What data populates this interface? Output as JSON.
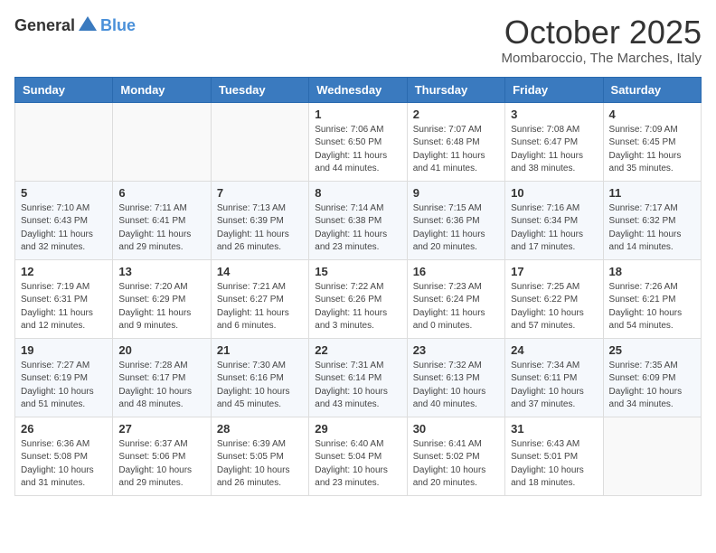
{
  "header": {
    "logo_general": "General",
    "logo_blue": "Blue",
    "month": "October 2025",
    "location": "Mombaroccio, The Marches, Italy"
  },
  "days_of_week": [
    "Sunday",
    "Monday",
    "Tuesday",
    "Wednesday",
    "Thursday",
    "Friday",
    "Saturday"
  ],
  "weeks": [
    [
      {
        "day": "",
        "info": ""
      },
      {
        "day": "",
        "info": ""
      },
      {
        "day": "",
        "info": ""
      },
      {
        "day": "1",
        "info": "Sunrise: 7:06 AM\nSunset: 6:50 PM\nDaylight: 11 hours and 44 minutes."
      },
      {
        "day": "2",
        "info": "Sunrise: 7:07 AM\nSunset: 6:48 PM\nDaylight: 11 hours and 41 minutes."
      },
      {
        "day": "3",
        "info": "Sunrise: 7:08 AM\nSunset: 6:47 PM\nDaylight: 11 hours and 38 minutes."
      },
      {
        "day": "4",
        "info": "Sunrise: 7:09 AM\nSunset: 6:45 PM\nDaylight: 11 hours and 35 minutes."
      }
    ],
    [
      {
        "day": "5",
        "info": "Sunrise: 7:10 AM\nSunset: 6:43 PM\nDaylight: 11 hours and 32 minutes."
      },
      {
        "day": "6",
        "info": "Sunrise: 7:11 AM\nSunset: 6:41 PM\nDaylight: 11 hours and 29 minutes."
      },
      {
        "day": "7",
        "info": "Sunrise: 7:13 AM\nSunset: 6:39 PM\nDaylight: 11 hours and 26 minutes."
      },
      {
        "day": "8",
        "info": "Sunrise: 7:14 AM\nSunset: 6:38 PM\nDaylight: 11 hours and 23 minutes."
      },
      {
        "day": "9",
        "info": "Sunrise: 7:15 AM\nSunset: 6:36 PM\nDaylight: 11 hours and 20 minutes."
      },
      {
        "day": "10",
        "info": "Sunrise: 7:16 AM\nSunset: 6:34 PM\nDaylight: 11 hours and 17 minutes."
      },
      {
        "day": "11",
        "info": "Sunrise: 7:17 AM\nSunset: 6:32 PM\nDaylight: 11 hours and 14 minutes."
      }
    ],
    [
      {
        "day": "12",
        "info": "Sunrise: 7:19 AM\nSunset: 6:31 PM\nDaylight: 11 hours and 12 minutes."
      },
      {
        "day": "13",
        "info": "Sunrise: 7:20 AM\nSunset: 6:29 PM\nDaylight: 11 hours and 9 minutes."
      },
      {
        "day": "14",
        "info": "Sunrise: 7:21 AM\nSunset: 6:27 PM\nDaylight: 11 hours and 6 minutes."
      },
      {
        "day": "15",
        "info": "Sunrise: 7:22 AM\nSunset: 6:26 PM\nDaylight: 11 hours and 3 minutes."
      },
      {
        "day": "16",
        "info": "Sunrise: 7:23 AM\nSunset: 6:24 PM\nDaylight: 11 hours and 0 minutes."
      },
      {
        "day": "17",
        "info": "Sunrise: 7:25 AM\nSunset: 6:22 PM\nDaylight: 10 hours and 57 minutes."
      },
      {
        "day": "18",
        "info": "Sunrise: 7:26 AM\nSunset: 6:21 PM\nDaylight: 10 hours and 54 minutes."
      }
    ],
    [
      {
        "day": "19",
        "info": "Sunrise: 7:27 AM\nSunset: 6:19 PM\nDaylight: 10 hours and 51 minutes."
      },
      {
        "day": "20",
        "info": "Sunrise: 7:28 AM\nSunset: 6:17 PM\nDaylight: 10 hours and 48 minutes."
      },
      {
        "day": "21",
        "info": "Sunrise: 7:30 AM\nSunset: 6:16 PM\nDaylight: 10 hours and 45 minutes."
      },
      {
        "day": "22",
        "info": "Sunrise: 7:31 AM\nSunset: 6:14 PM\nDaylight: 10 hours and 43 minutes."
      },
      {
        "day": "23",
        "info": "Sunrise: 7:32 AM\nSunset: 6:13 PM\nDaylight: 10 hours and 40 minutes."
      },
      {
        "day": "24",
        "info": "Sunrise: 7:34 AM\nSunset: 6:11 PM\nDaylight: 10 hours and 37 minutes."
      },
      {
        "day": "25",
        "info": "Sunrise: 7:35 AM\nSunset: 6:09 PM\nDaylight: 10 hours and 34 minutes."
      }
    ],
    [
      {
        "day": "26",
        "info": "Sunrise: 6:36 AM\nSunset: 5:08 PM\nDaylight: 10 hours and 31 minutes."
      },
      {
        "day": "27",
        "info": "Sunrise: 6:37 AM\nSunset: 5:06 PM\nDaylight: 10 hours and 29 minutes."
      },
      {
        "day": "28",
        "info": "Sunrise: 6:39 AM\nSunset: 5:05 PM\nDaylight: 10 hours and 26 minutes."
      },
      {
        "day": "29",
        "info": "Sunrise: 6:40 AM\nSunset: 5:04 PM\nDaylight: 10 hours and 23 minutes."
      },
      {
        "day": "30",
        "info": "Sunrise: 6:41 AM\nSunset: 5:02 PM\nDaylight: 10 hours and 20 minutes."
      },
      {
        "day": "31",
        "info": "Sunrise: 6:43 AM\nSunset: 5:01 PM\nDaylight: 10 hours and 18 minutes."
      },
      {
        "day": "",
        "info": ""
      }
    ]
  ]
}
